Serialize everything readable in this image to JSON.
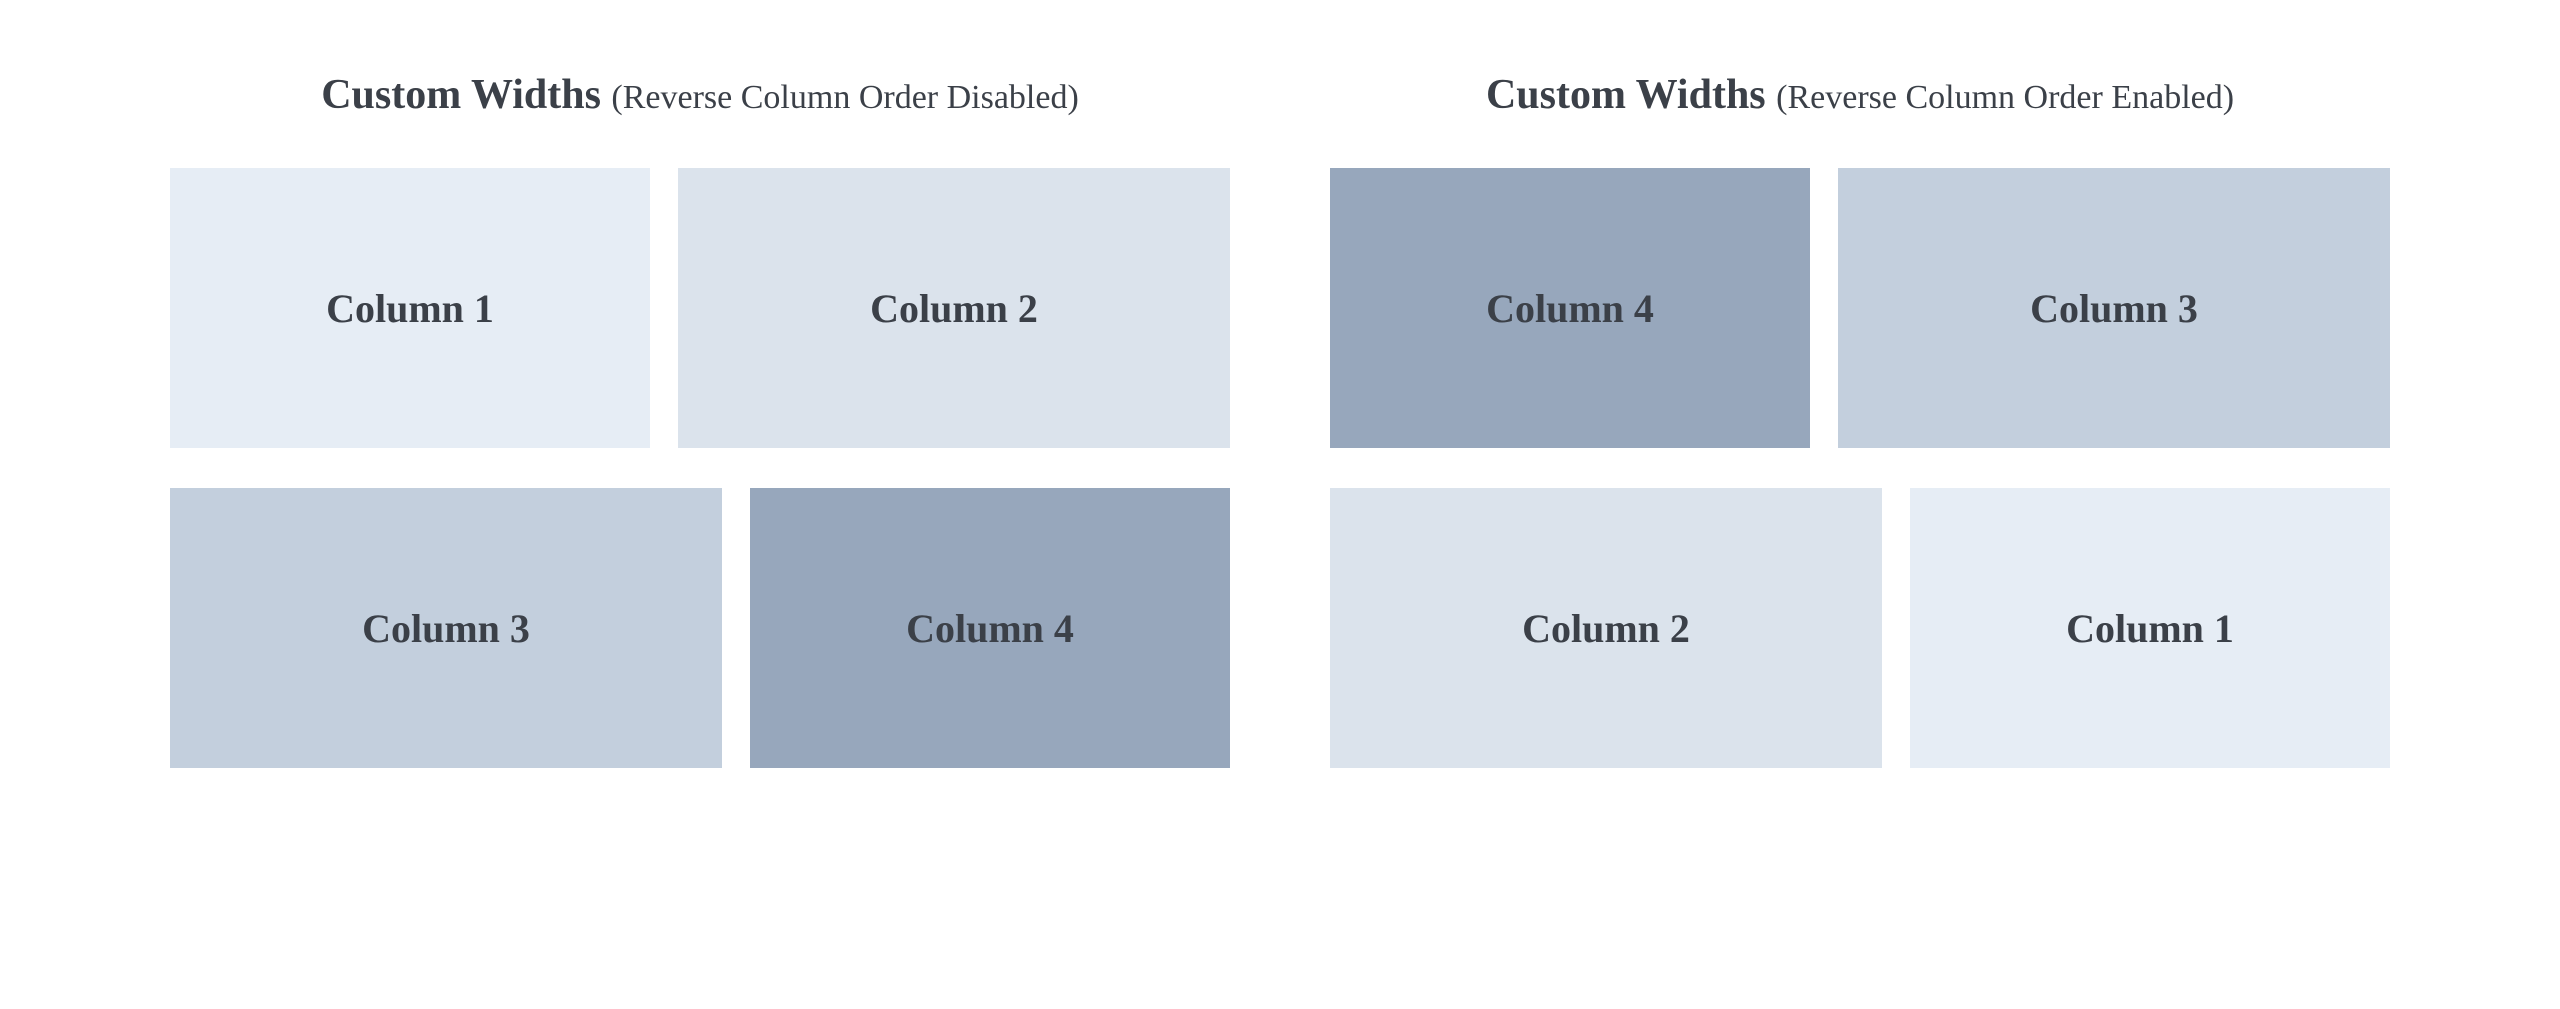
{
  "panels": [
    {
      "title_main": "Custom Widths",
      "title_sub": "(Reverse Column Order Disabled)",
      "cells": {
        "r0c0": "Column 1",
        "r0c1": "Column 2",
        "r1c0": "Column 3",
        "r1c1": "Column 4"
      }
    },
    {
      "title_main": "Custom Widths",
      "title_sub": "(Reverse Column Order Enabled)",
      "cells": {
        "r0c0": "Column 4",
        "r0c1": "Column 3",
        "r1c0": "Column 2",
        "r1c1": "Column 1"
      }
    }
  ],
  "colors": {
    "shade1": "#e6edf5",
    "shade2": "#dbe3ec",
    "shade3": "#c3cfdd",
    "shade4": "#97a7bc"
  }
}
